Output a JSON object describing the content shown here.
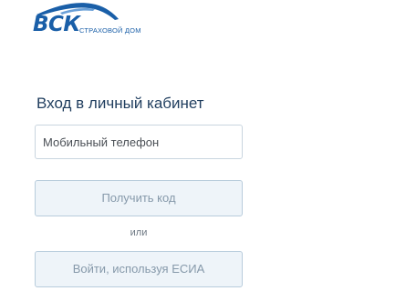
{
  "brand": {
    "logo_text": "ВСК",
    "logo_subtitle": "СТРАХОВОЙ ДОМ",
    "color": "#1a5fa8"
  },
  "login": {
    "title": "Вход в личный кабинет",
    "phone_placeholder": "Мобильный телефон",
    "phone_value": "",
    "get_code_label": "Получить код",
    "or_label": "или",
    "esia_label": "Войти, используя ЕСИА"
  }
}
